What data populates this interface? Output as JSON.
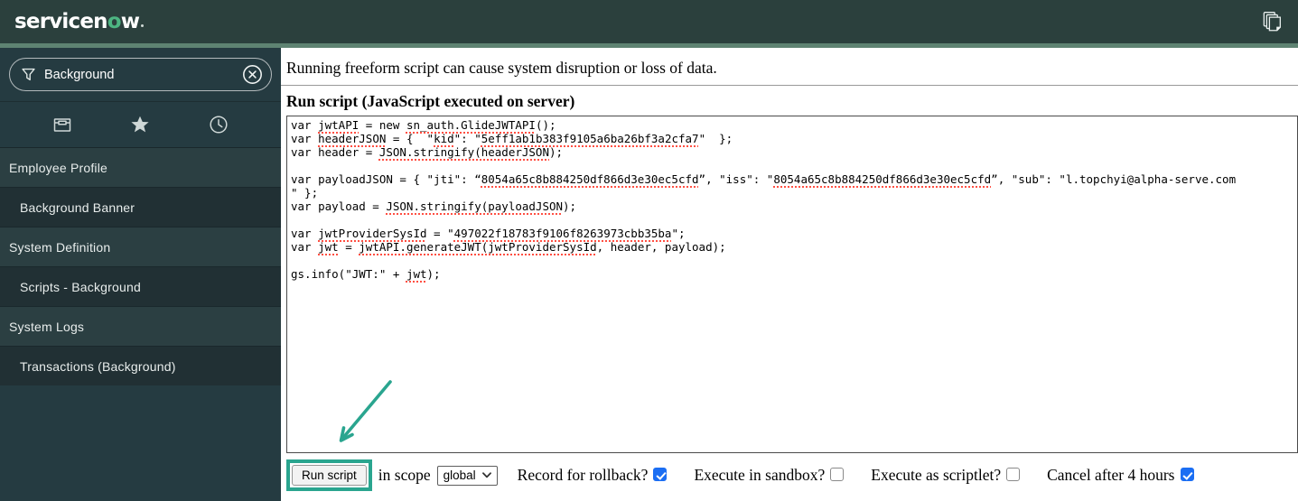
{
  "colors": {
    "header_bg": "#2b403d",
    "accent_bar": "#5e8372",
    "sidebar_section_bg": "#2b3f42",
    "sidebar_module_bg": "#213034",
    "logo_green": "#4db582",
    "annotation_teal": "#2aa58f",
    "checkbox_blue": "#1b6ef3",
    "squiggle_red": "#ff4f42"
  },
  "header": {
    "logo": {
      "prefix": "servicen",
      "o": "o",
      "suffix": "w"
    },
    "icons": [
      "copy-pages-icon"
    ]
  },
  "sidebar": {
    "filter": {
      "value": "Background"
    },
    "tabs": [
      {
        "icon": "all-applications-box-icon"
      },
      {
        "icon": "favorites-star-icon"
      },
      {
        "icon": "history-clock-icon"
      }
    ],
    "items": [
      {
        "label": "Employee Profile",
        "type": "section"
      },
      {
        "label": "Background Banner",
        "type": "module"
      },
      {
        "label": "System Definition",
        "type": "section"
      },
      {
        "label": "Scripts - Background",
        "type": "module"
      },
      {
        "label": "System Logs",
        "type": "section"
      },
      {
        "label": "Transactions (Background)",
        "type": "module"
      }
    ]
  },
  "main": {
    "warning": "Running freeform script can cause system disruption or loss of data.",
    "heading": "Run script (JavaScript executed on server)",
    "script": {
      "lines": [
        [
          [
            "var ",
            0
          ],
          [
            "jwtAPI",
            1
          ],
          [
            " = new ",
            0
          ],
          [
            "sn_auth.GlideJWTAPI",
            1
          ],
          [
            "();",
            0
          ]
        ],
        [
          [
            "var ",
            0
          ],
          [
            "headerJSON",
            1
          ],
          [
            " = {  \"",
            0
          ],
          [
            "kid",
            1
          ],
          [
            "\": \"",
            0
          ],
          [
            "5eff1ab1b383f9105a6ba26bf3a2cfa7",
            1
          ],
          [
            "\"  };",
            0
          ]
        ],
        [
          [
            "var header = ",
            0
          ],
          [
            "JSON.stringify(headerJSON",
            1
          ],
          [
            ");",
            0
          ]
        ],
        [
          [
            "",
            0
          ]
        ],
        [
          [
            "var payloadJSON = { \"jti\": “",
            0
          ],
          [
            "8054a65c8b884250df866d3e30ec5cfd",
            1
          ],
          [
            "”, \"iss\": \"",
            0
          ],
          [
            "8054a65c8b884250df866d3e30ec5cfd",
            1
          ],
          [
            "”, \"sub\": \"l.topchyi@alpha-serve.com",
            0
          ]
        ],
        [
          [
            "\" };",
            0
          ]
        ],
        [
          [
            "var payload = ",
            0
          ],
          [
            "JSON.stringify(payloadJSON",
            1
          ],
          [
            ");",
            0
          ]
        ],
        [
          [
            "",
            0
          ]
        ],
        [
          [
            "var ",
            0
          ],
          [
            "jwtProviderSysId",
            1
          ],
          [
            " = \"",
            0
          ],
          [
            "497022f18783f9106f8263973cbb35ba",
            1
          ],
          [
            "\";",
            0
          ]
        ],
        [
          [
            "var ",
            0
          ],
          [
            "jwt",
            1
          ],
          [
            " = ",
            0
          ],
          [
            "jwtAPI.generateJWT(jwtProviderSysId",
            1
          ],
          [
            ", header, payload);",
            0
          ]
        ],
        [
          [
            "",
            0
          ]
        ],
        [
          [
            "gs.info(\"JWT:\" + ",
            0
          ],
          [
            "jwt",
            1
          ],
          [
            ");",
            0
          ]
        ]
      ]
    },
    "controls": {
      "run_button": "Run script",
      "scope_label": "in scope",
      "scope_value": "global",
      "checkboxes": [
        {
          "label": "Record for rollback?",
          "checked": true
        },
        {
          "label": "Execute in sandbox?",
          "checked": false
        },
        {
          "label": "Execute as scriptlet?",
          "checked": false
        },
        {
          "label": "Cancel after 4 hours",
          "checked": true
        }
      ]
    }
  }
}
